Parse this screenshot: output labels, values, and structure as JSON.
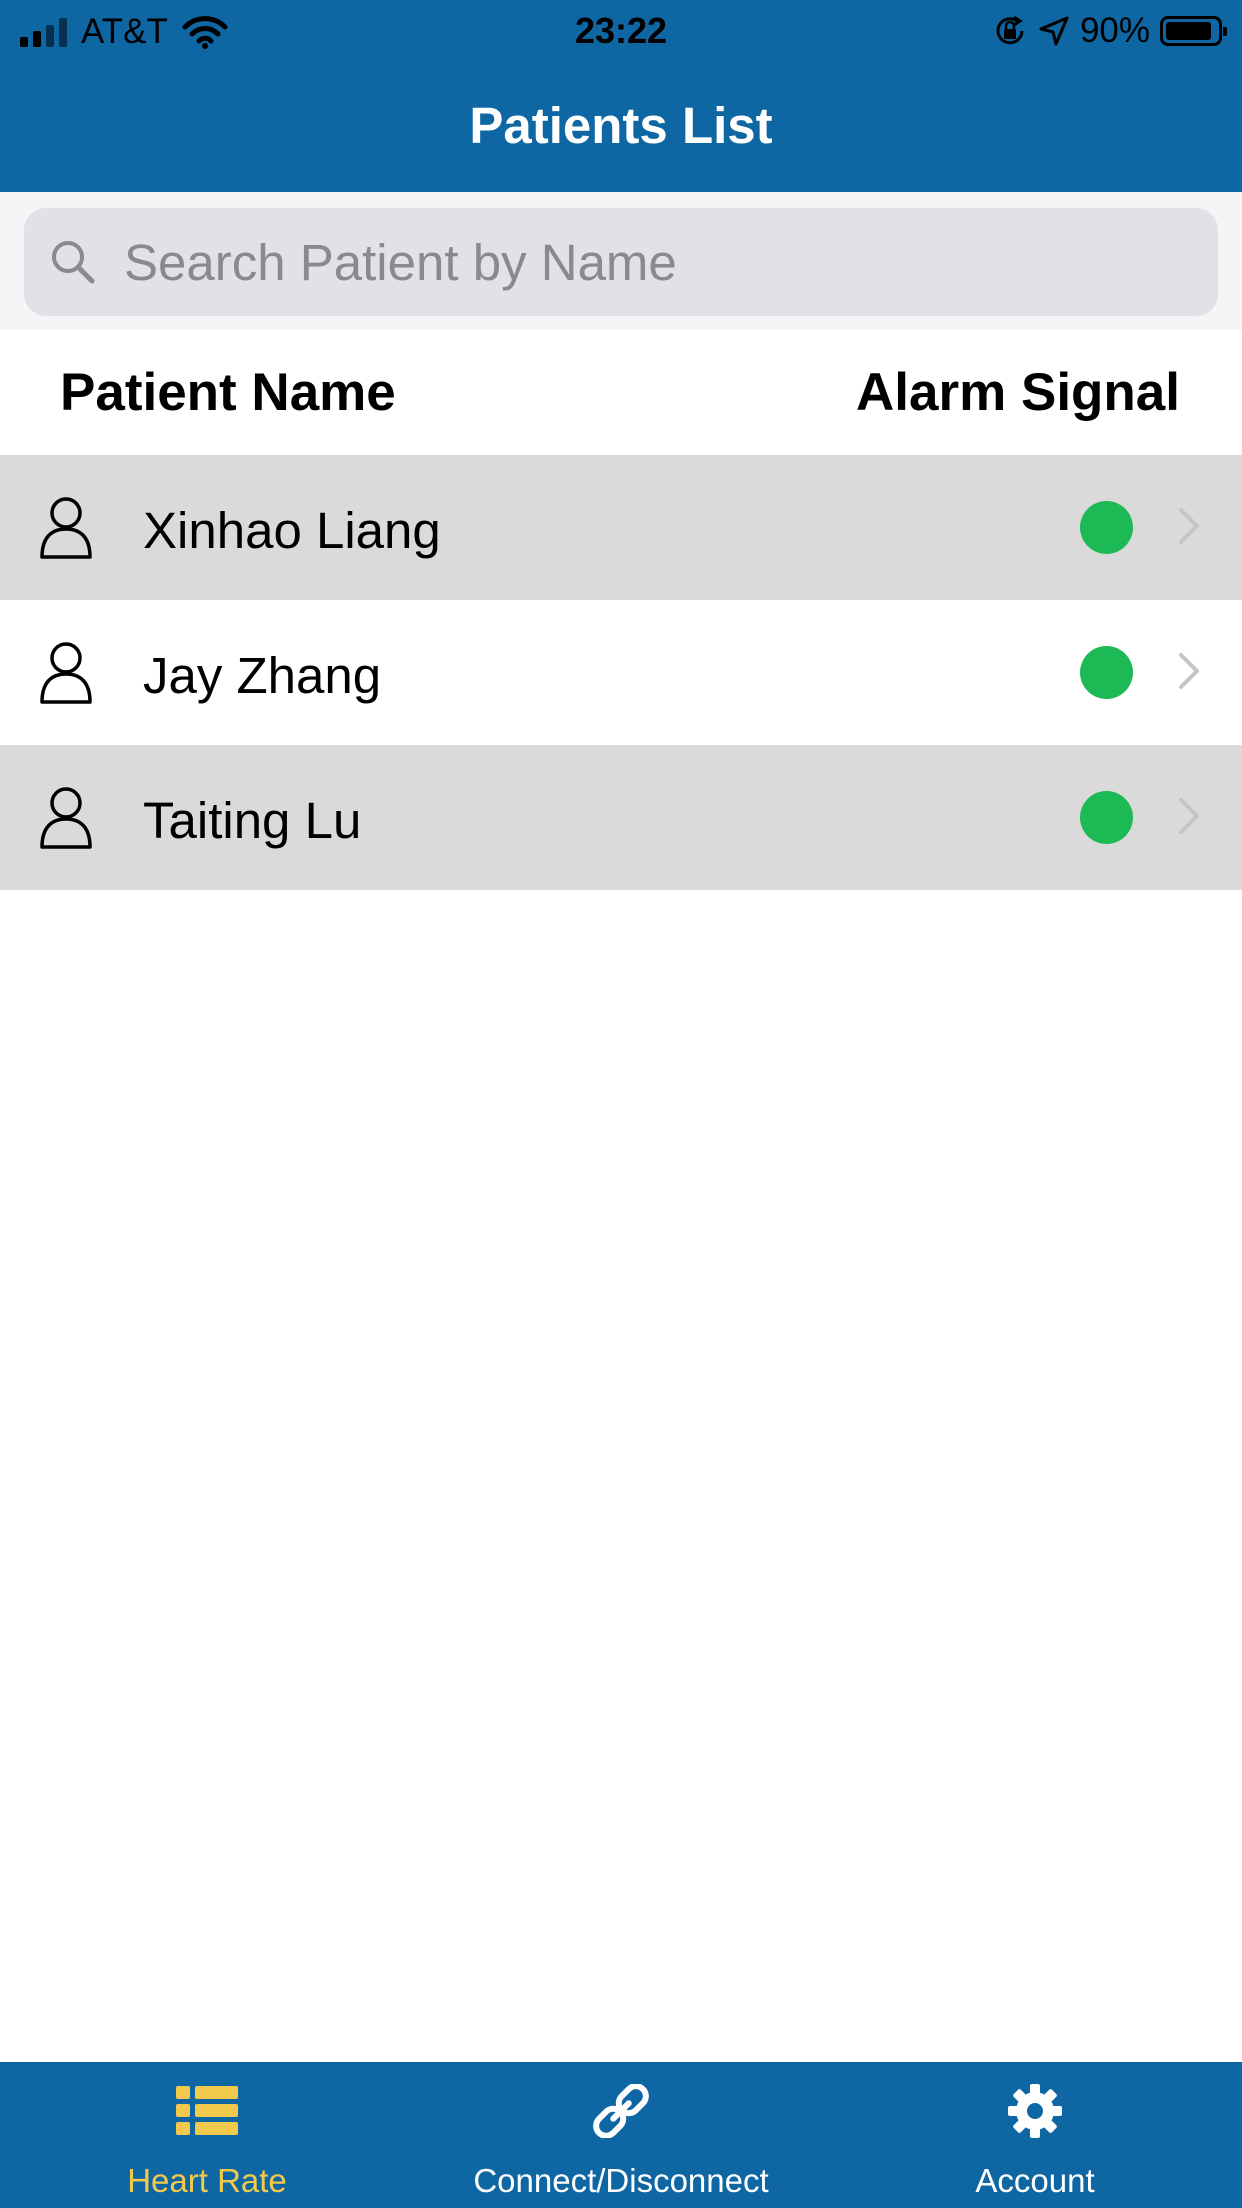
{
  "status_bar": {
    "carrier": "AT&T",
    "time": "23:22",
    "battery_percent": "90%",
    "battery_level": 0.9,
    "signal_bars_on": 2,
    "signal_bars_total": 4
  },
  "nav": {
    "title": "Patients List"
  },
  "search": {
    "value": "",
    "placeholder": "Search Patient by Name"
  },
  "list_header": {
    "name_label": "Patient Name",
    "alarm_label": "Alarm Signal"
  },
  "patients": [
    {
      "name": "Xinhao Liang",
      "alarm_color": "#1db954",
      "icon": "person-icon"
    },
    {
      "name": "Jay Zhang",
      "alarm_color": "#1db954",
      "icon": "person-icon"
    },
    {
      "name": "Taiting Lu",
      "alarm_color": "#1db954",
      "icon": "person-icon"
    }
  ],
  "tabs": [
    {
      "label": "Heart Rate",
      "icon": "list-icon",
      "active": true
    },
    {
      "label": "Connect/Disconnect",
      "icon": "link-icon",
      "active": false
    },
    {
      "label": "Account",
      "icon": "gear-icon",
      "active": false
    }
  ],
  "colors": {
    "brand_blue": "#0e66a3",
    "active_tab": "#f2c94c",
    "inactive_tab": "#ffffff",
    "alarm_ok": "#1db954",
    "row_shade": "#dadada"
  }
}
